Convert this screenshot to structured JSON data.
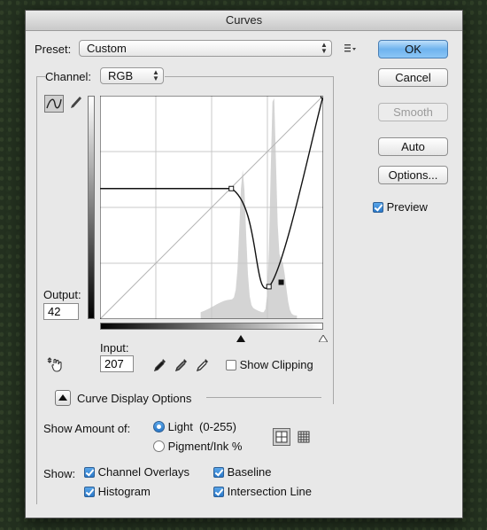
{
  "window": {
    "title": "Curves"
  },
  "preset": {
    "label": "Preset:",
    "value": "Custom"
  },
  "channel": {
    "label": "Channel:",
    "value": "RGB"
  },
  "buttons": {
    "ok": "OK",
    "cancel": "Cancel",
    "smooth": "Smooth",
    "auto": "Auto",
    "options": "Options..."
  },
  "preview": {
    "label": "Preview",
    "checked": true
  },
  "output": {
    "label": "Output:",
    "value": "42"
  },
  "input": {
    "label": "Input:",
    "value": "207"
  },
  "show_clipping": {
    "label": "Show Clipping",
    "checked": false
  },
  "curve_display": {
    "label": "Curve Display Options"
  },
  "show_amount": {
    "label": "Show Amount of:",
    "light": "Light  (0-255)",
    "pigment": "Pigment/Ink %",
    "selected": "light"
  },
  "show": {
    "label": "Show:",
    "channel_overlays": "Channel Overlays",
    "baseline": "Baseline",
    "histogram": "Histogram",
    "intersection_line": "Intersection Line"
  },
  "curve": {
    "points": [
      [
        0,
        149
      ],
      [
        150,
        149
      ],
      [
        193,
        37
      ],
      [
        255,
        255
      ]
    ],
    "selected_point": [
      207,
      42
    ]
  },
  "colors": {
    "accent": "#3c8de0",
    "histogram": "#d4d4d4"
  }
}
